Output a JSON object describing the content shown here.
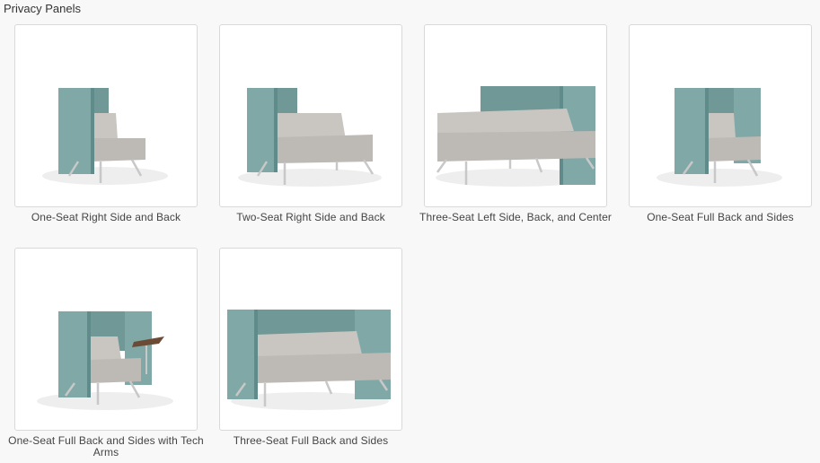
{
  "page": {
    "title": "Privacy Panels"
  },
  "products": [
    {
      "label": "One-Seat Right Side and Back",
      "image": "one-seat-right-side-and-back"
    },
    {
      "label": "Two-Seat Right Side and Back",
      "image": "two-seat-right-side-and-back"
    },
    {
      "label": "Three-Seat Left Side, Back, and Center",
      "image": "three-seat-left-side-back-center"
    },
    {
      "label": "One-Seat Full Back and Sides",
      "image": "one-seat-full-back-and-sides"
    },
    {
      "label": "One-Seat Full Back and Sides with Tech Arms",
      "image": "one-seat-full-back-sides-tech-arms"
    },
    {
      "label": "Three-Seat Full Back and Sides",
      "image": "three-seat-full-back-and-sides"
    }
  ],
  "colors": {
    "panel": "#7fa8a6",
    "panel_dark": "#5f8c8a",
    "upholstery": "#c9c5c1",
    "upholstery_dark": "#aaa6a2",
    "leg": "#c8c8c8",
    "tablet": "#6b4a36"
  }
}
